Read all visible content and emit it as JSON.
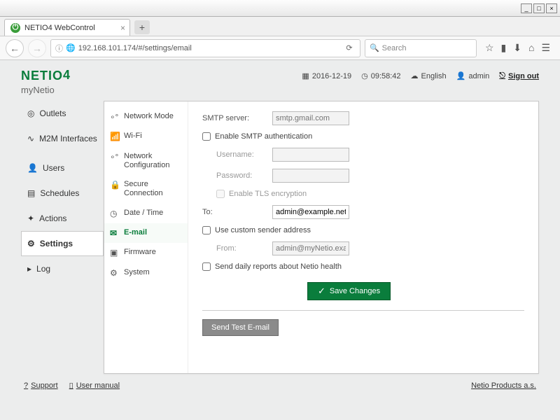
{
  "browser": {
    "tab_title": "NETIO4 WebControl",
    "url": "192.168.101.174/#/settings/email",
    "search_placeholder": "Search"
  },
  "brand": "NETIO",
  "brand_suffix": "4",
  "device_name": "myNetio",
  "header": {
    "date": "2016-12-19",
    "time": "09:58:42",
    "language": "English",
    "user": "admin",
    "signout": "Sign out"
  },
  "nav": {
    "outlets": "Outlets",
    "m2m": "M2M Interfaces",
    "users": "Users",
    "schedules": "Schedules",
    "actions": "Actions",
    "settings": "Settings",
    "log": "Log"
  },
  "subnav": {
    "network_mode": "Network Mode",
    "wifi": "Wi-Fi",
    "network_config": "Network Configuration",
    "secure": "Secure Connection",
    "datetime": "Date / Time",
    "email": "E-mail",
    "firmware": "Firmware",
    "system": "System"
  },
  "form": {
    "smtp_server_label": "SMTP server:",
    "smtp_server_placeholder": "smtp.gmail.com",
    "enable_auth": "Enable SMTP authentication",
    "username_label": "Username:",
    "password_label": "Password:",
    "enable_tls": "Enable TLS encryption",
    "to_label": "To:",
    "to_value": "admin@example.net",
    "custom_sender": "Use custom sender address",
    "from_label": "From:",
    "from_placeholder": "admin@myNetio.example",
    "daily_reports": "Send daily reports about Netio health",
    "save": "Save Changes",
    "send_test": "Send Test E-mail"
  },
  "footer": {
    "support": "Support",
    "manual": "User manual",
    "company": "Netio Products a.s."
  }
}
